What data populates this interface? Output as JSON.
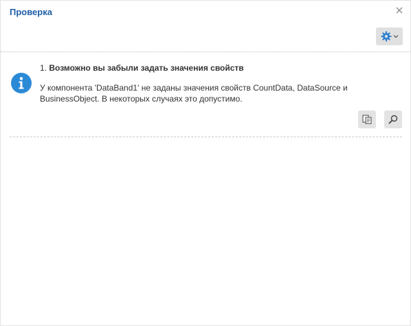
{
  "dialog": {
    "title": "Проверка",
    "close_icon": "close-icon",
    "settings_icon": "gear-icon",
    "accent": "#1f5ea8"
  },
  "items": [
    {
      "number": "1.",
      "title": "Возможно вы забыли задать значения свойств",
      "description": "У компонента 'DataBand1' не заданы значения свойств CountData, DataSource и BusinessObject. В некоторых случаях это допустимо.",
      "icon": "info-icon",
      "icon_color": "#2b8ad6",
      "actions": [
        "copy-icon",
        "search-icon"
      ]
    }
  ]
}
